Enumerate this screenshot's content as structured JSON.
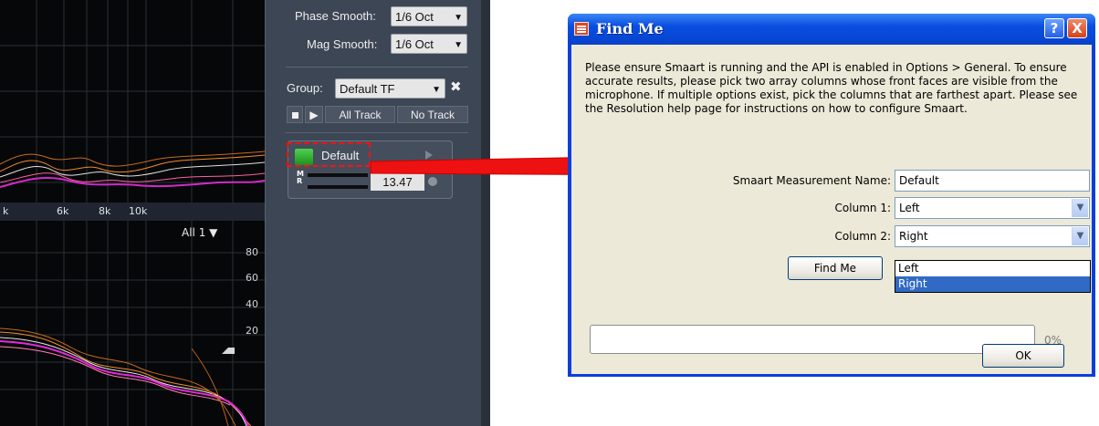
{
  "smaart": {
    "freq_labels": [
      "k",
      "6k",
      "8k",
      "10k"
    ],
    "view_selector": "All 1 ▼",
    "y_ticks": [
      "80",
      "60",
      "40",
      "20"
    ],
    "phase_smooth_label": "Phase Smooth:",
    "phase_smooth_value": "1/6 Oct",
    "mag_smooth_label": "Mag Smooth:",
    "mag_smooth_value": "1/6 Oct",
    "group_label": "Group:",
    "group_value": "Default TF",
    "all_track_label": "All Track",
    "no_track_label": "No Track",
    "measurement_name": "Default",
    "meter_labels": "M\nR",
    "delay_value": "13.47",
    "colors": {
      "highlight": "#ff1010",
      "status_led": "#2ea82e"
    }
  },
  "dialog": {
    "title": "Find Me",
    "help_button": "?",
    "close_button": "X",
    "instructions": "Please ensure Smaart is running and the API is enabled in Options > General. To ensure accurate results, please pick two array columns whose front faces are visible from the microphone. If multiple options exist, pick the columns that are farthest apart. Please see the Resolution help page for instructions on how to configure Smaart.",
    "measurement_label": "Smaart Measurement Name:",
    "measurement_value": "Default",
    "column1_label": "Column 1:",
    "column1_value": "Left",
    "column2_label": "Column 2:",
    "column2_value": "Right",
    "dropdown_options": [
      "Left",
      "Right"
    ],
    "find_me_button": "Find Me",
    "progress_percent": "0%",
    "progress_value": 0,
    "ok_button": "OK",
    "colors": {
      "titlebar": "#0a4ee0",
      "client": "#ece9d8",
      "selection": "#316ac5"
    }
  }
}
